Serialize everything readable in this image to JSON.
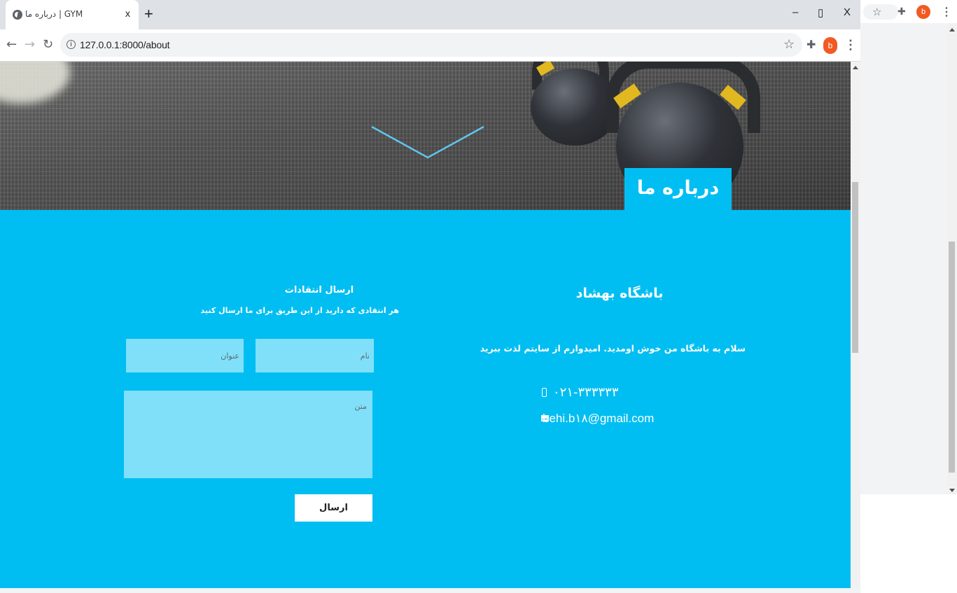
{
  "browser": {
    "tab_title": "درباره ما | GYM",
    "tab_close": "x",
    "new_tab": "+",
    "window_controls": {
      "minimize": "–",
      "maximize": "▯",
      "close": "X"
    },
    "url": "127.0.0.1:8000/about",
    "profile_initial": "b"
  },
  "hero": {
    "page_label": "درباره ما"
  },
  "info": {
    "gym_name": "باشگاه بهشاد",
    "welcome_text": "سلام به باشگاه من خوش اومدید. امیدوارم از سایتم لذت ببرید",
    "phone": "۰۲۱-۳۳۳۳۳۳",
    "email": "behi.b۱۸@gmail.com"
  },
  "form": {
    "title": "ارسال انتقادات",
    "subtitle": "هر انتقادی که دارید از این طریق برای ما ارسال کنید",
    "name_placeholder": "نام",
    "subject_placeholder": "عنوان",
    "body_placeholder": "متن",
    "submit_label": "ارسال"
  },
  "second_window": {
    "profile_initial": "b"
  },
  "colors": {
    "accent": "#00bef2",
    "field": "#80e0f9",
    "brand_avatar": "#f15a22"
  }
}
